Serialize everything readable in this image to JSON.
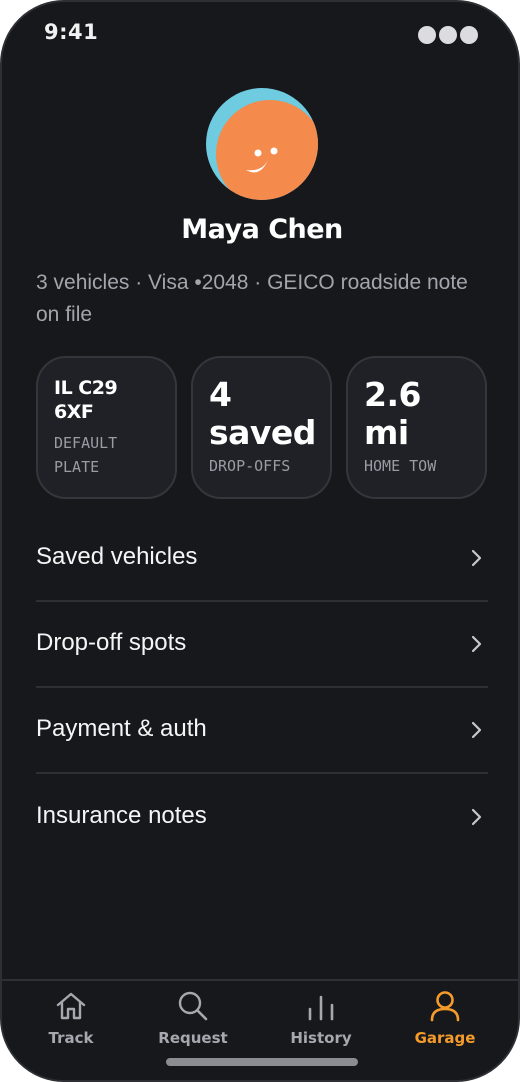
{
  "status_bar": {
    "time": "9:41"
  },
  "profile": {
    "name": "Maya Chen",
    "summary": "3 vehicles · Visa •2048 · GEICO roadside note on file",
    "avatar_colors": {
      "background": "#6ecbe0",
      "face": "#f48a4b"
    }
  },
  "stats": [
    {
      "value": "IL C29 6XF",
      "label": "DEFAULT PLATE"
    },
    {
      "value": "4 saved",
      "label": "DROP-OFFS"
    },
    {
      "value": "2.6 mi",
      "label": "HOME TOW"
    }
  ],
  "menu": [
    {
      "label": "Saved vehicles",
      "icon": "chevron-right-icon"
    },
    {
      "label": "Drop-off spots",
      "icon": "chevron-right-icon"
    },
    {
      "label": "Payment & auth",
      "icon": "chevron-right-icon"
    },
    {
      "label": "Insurance notes",
      "icon": "chevron-right-icon"
    }
  ],
  "tabs": [
    {
      "label": "Track",
      "icon": "home-icon",
      "active": false
    },
    {
      "label": "Request",
      "icon": "search-icon",
      "active": false
    },
    {
      "label": "History",
      "icon": "bar-chart-icon",
      "active": false
    },
    {
      "label": "Garage",
      "icon": "user-icon",
      "active": true
    }
  ],
  "colors": {
    "background": "#17181b",
    "card": "#1f2126",
    "accent": "#f59b2b",
    "muted_text": "#a3a5ad"
  }
}
